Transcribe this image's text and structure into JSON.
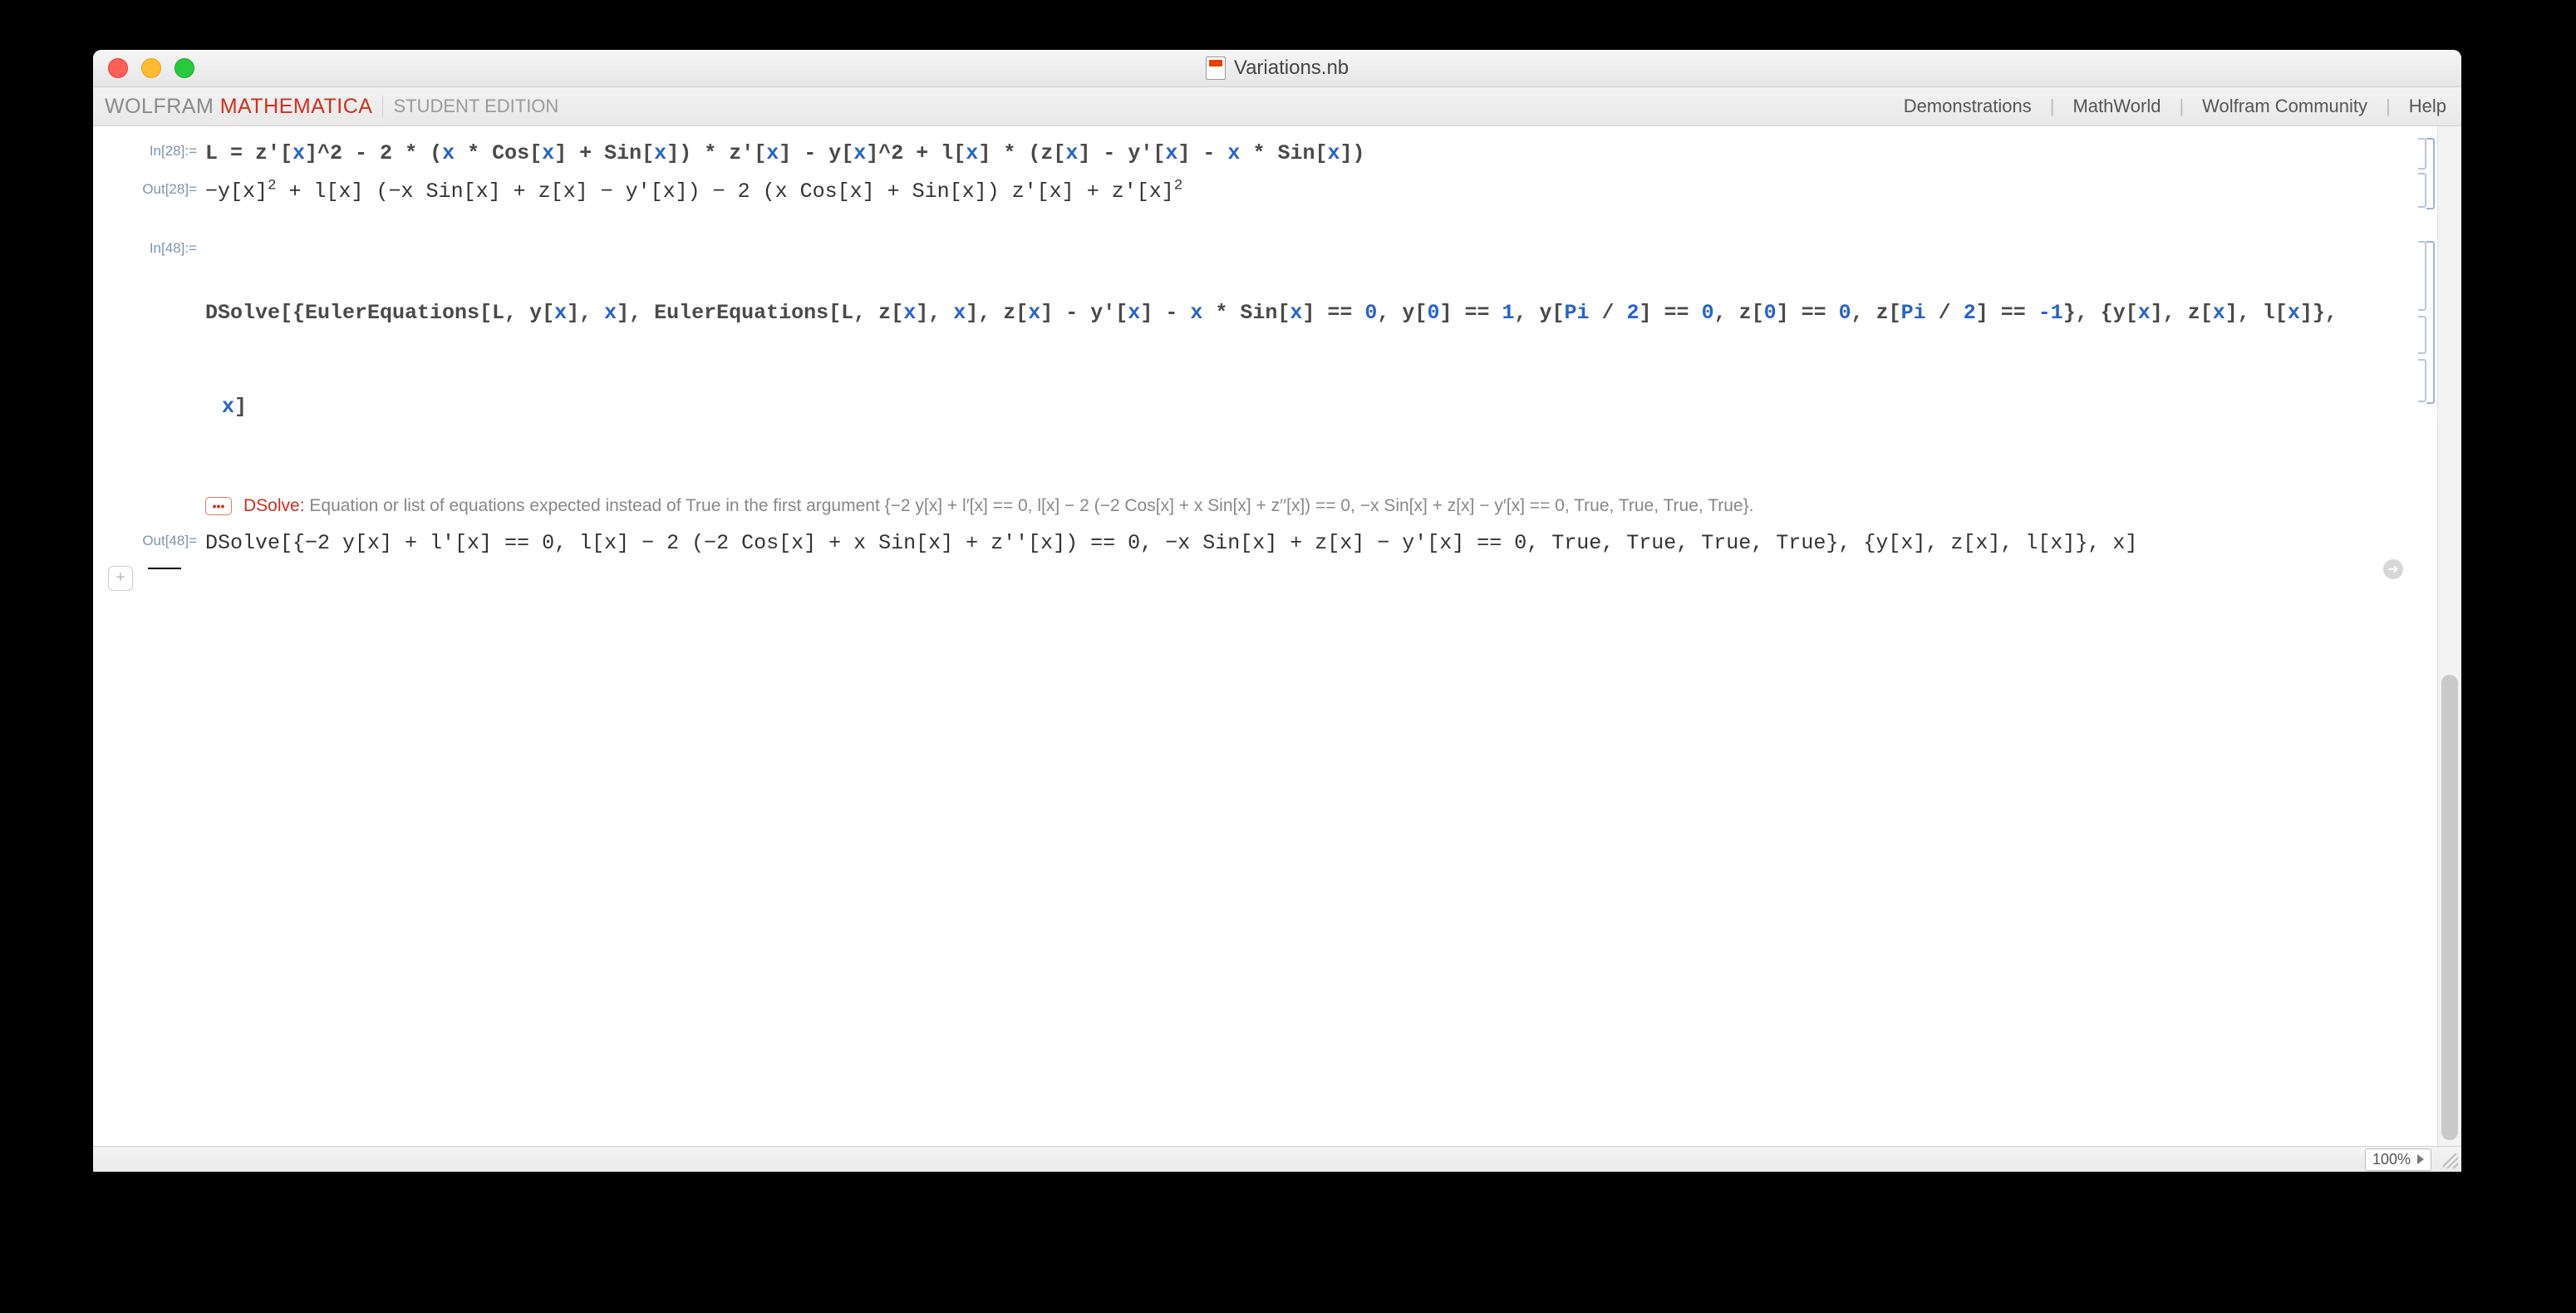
{
  "window": {
    "title": "Variations.nb"
  },
  "toolbar": {
    "brand_wolfram": "WOLFRAM",
    "brand_mathematica": "MATHEMATICA",
    "edition": "STUDENT EDITION",
    "links": {
      "demonstrations": "Demonstrations",
      "mathworld": "MathWorld",
      "community": "Wolfram Community",
      "help": "Help"
    }
  },
  "cells": {
    "in28": {
      "label": "In[28]:=",
      "tokens": [
        {
          "t": "L = z'[",
          "c": "br"
        },
        {
          "t": "x",
          "c": "bl"
        },
        {
          "t": "]^2 - 2 * (",
          "c": "br"
        },
        {
          "t": "x",
          "c": "bl"
        },
        {
          "t": " * Cos[",
          "c": "br"
        },
        {
          "t": "x",
          "c": "bl"
        },
        {
          "t": "] + Sin[",
          "c": "br"
        },
        {
          "t": "x",
          "c": "bl"
        },
        {
          "t": "]) * z'[",
          "c": "br"
        },
        {
          "t": "x",
          "c": "bl"
        },
        {
          "t": "] - y[",
          "c": "br"
        },
        {
          "t": "x",
          "c": "bl"
        },
        {
          "t": "]^2 + l[",
          "c": "br"
        },
        {
          "t": "x",
          "c": "bl"
        },
        {
          "t": "] * (z[",
          "c": "br"
        },
        {
          "t": "x",
          "c": "bl"
        },
        {
          "t": "] - y'[",
          "c": "br"
        },
        {
          "t": "x",
          "c": "bl"
        },
        {
          "t": "] - ",
          "c": "br"
        },
        {
          "t": "x",
          "c": "bl"
        },
        {
          "t": " * Sin[",
          "c": "br"
        },
        {
          "t": "x",
          "c": "bl"
        },
        {
          "t": "])",
          "c": "br"
        }
      ]
    },
    "out28": {
      "label": "Out[28]=",
      "text_html": "−y[x]<span class='sup'>2</span> + l[x] (−x Sin[x] + z[x] − y′[x]) − 2 (x Cos[x] + Sin[x]) z′[x] + z′[x]<span class='sup'>2</span>"
    },
    "in48": {
      "label": "In[48]:=",
      "tokens_line1": [
        {
          "t": "DSolve[{EulerEquations[L, y[",
          "c": "br"
        },
        {
          "t": "x",
          "c": "bl"
        },
        {
          "t": "], ",
          "c": "br"
        },
        {
          "t": "x",
          "c": "bl"
        },
        {
          "t": "], EulerEquations[L, z[",
          "c": "br"
        },
        {
          "t": "x",
          "c": "bl"
        },
        {
          "t": "], ",
          "c": "br"
        },
        {
          "t": "x",
          "c": "bl"
        },
        {
          "t": "], z[",
          "c": "br"
        },
        {
          "t": "x",
          "c": "bl"
        },
        {
          "t": "] - y'[",
          "c": "br"
        },
        {
          "t": "x",
          "c": "bl"
        },
        {
          "t": "] - ",
          "c": "br"
        },
        {
          "t": "x",
          "c": "bl"
        },
        {
          "t": " * Sin[",
          "c": "br"
        },
        {
          "t": "x",
          "c": "bl"
        },
        {
          "t": "] == ",
          "c": "br"
        },
        {
          "t": "0",
          "c": "bl"
        },
        {
          "t": ", y[",
          "c": "br"
        },
        {
          "t": "0",
          "c": "bl"
        },
        {
          "t": "] == ",
          "c": "br"
        },
        {
          "t": "1",
          "c": "bl"
        },
        {
          "t": ", y[",
          "c": "br"
        },
        {
          "t": "Pi",
          "c": "bl"
        },
        {
          "t": " / ",
          "c": "br"
        },
        {
          "t": "2",
          "c": "bl"
        },
        {
          "t": "] == ",
          "c": "br"
        },
        {
          "t": "0",
          "c": "bl"
        },
        {
          "t": ", z[",
          "c": "br"
        },
        {
          "t": "0",
          "c": "bl"
        },
        {
          "t": "] == ",
          "c": "br"
        },
        {
          "t": "0",
          "c": "bl"
        },
        {
          "t": ", z[",
          "c": "br"
        },
        {
          "t": "Pi",
          "c": "bl"
        },
        {
          "t": " / ",
          "c": "br"
        },
        {
          "t": "2",
          "c": "bl"
        },
        {
          "t": "] == ",
          "c": "br"
        },
        {
          "t": "-1",
          "c": "bl"
        },
        {
          "t": "}, {y[",
          "c": "br"
        },
        {
          "t": "x",
          "c": "bl"
        },
        {
          "t": "], z[",
          "c": "br"
        },
        {
          "t": "x",
          "c": "bl"
        },
        {
          "t": "], l[",
          "c": "br"
        },
        {
          "t": "x",
          "c": "bl"
        },
        {
          "t": "]},",
          "c": "br"
        }
      ],
      "tokens_line2": [
        {
          "t": "x",
          "c": "bl"
        },
        {
          "t": "]",
          "c": "br"
        }
      ]
    },
    "msg48": {
      "ellipsis": "•••",
      "head": "DSolve",
      "colon": ":",
      "body": "Equation or list of equations expected instead of True in the first argument {−2 y[x] + l′[x] == 0, l[x] − 2 (−2 Cos[x] + x Sin[x] + z′′[x]) == 0, −x Sin[x] + z[x] − y′[x] == 0, True, True, True, True}."
    },
    "out48": {
      "label": "Out[48]=",
      "text": "DSolve[{−2 y[x] + l′[x] == 0, l[x] − 2 (−2 Cos[x] + x Sin[x] + z′′[x]) == 0, −x Sin[x] + z[x] − y′[x] == 0, True, True, True, True}, {y[x], z[x], l[x]}, x]"
    }
  },
  "status": {
    "zoom": "100%"
  }
}
